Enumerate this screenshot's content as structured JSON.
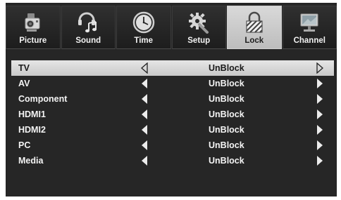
{
  "tabs": [
    {
      "label": "Picture",
      "icon": "camera-icon",
      "active": false
    },
    {
      "label": "Sound",
      "icon": "music-note-icon",
      "active": false
    },
    {
      "label": "Time",
      "icon": "clock-icon",
      "active": false
    },
    {
      "label": "Setup",
      "icon": "gear-icon",
      "active": false
    },
    {
      "label": "Lock",
      "icon": "padlock-icon",
      "active": true
    },
    {
      "label": "Channel",
      "icon": "monitor-icon",
      "active": false
    }
  ],
  "lock_menu": {
    "rows": [
      {
        "name": "TV",
        "value": "UnBlock",
        "selected": true
      },
      {
        "name": "AV",
        "value": "UnBlock",
        "selected": false
      },
      {
        "name": "Component",
        "value": "UnBlock",
        "selected": false
      },
      {
        "name": "HDMI1",
        "value": "UnBlock",
        "selected": false
      },
      {
        "name": "HDMI2",
        "value": "UnBlock",
        "selected": false
      },
      {
        "name": "PC",
        "value": "UnBlock",
        "selected": false
      },
      {
        "name": "Media",
        "value": "UnBlock",
        "selected": false
      }
    ]
  },
  "colors": {
    "background": "#262626",
    "selected_row": "#d6d6d6",
    "active_tab": "#cccccc",
    "text": "#f4f4f4"
  }
}
